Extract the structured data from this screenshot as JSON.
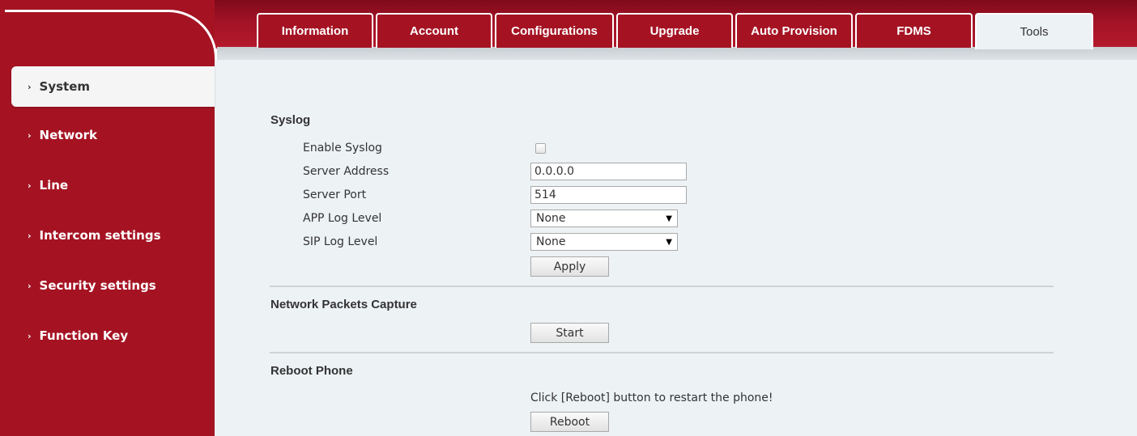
{
  "tabs": [
    {
      "label": "Information"
    },
    {
      "label": "Account"
    },
    {
      "label": "Configurations"
    },
    {
      "label": "Upgrade"
    },
    {
      "label": "Auto Provision"
    },
    {
      "label": "FDMS"
    },
    {
      "label": "Tools"
    }
  ],
  "active_tab": "Tools",
  "sidebar": {
    "items": [
      {
        "label": "System"
      },
      {
        "label": "Network"
      },
      {
        "label": "Line"
      },
      {
        "label": "Intercom settings"
      },
      {
        "label": "Security settings"
      },
      {
        "label": "Function Key"
      }
    ],
    "active": "System",
    "chevron": "›"
  },
  "syslog": {
    "title": "Syslog",
    "enable_label": "Enable Syslog",
    "enable_checked": false,
    "server_address_label": "Server Address",
    "server_address_value": "0.0.0.0",
    "server_port_label": "Server Port",
    "server_port_value": "514",
    "app_log_label": "APP Log Level",
    "app_log_value": "None",
    "sip_log_label": "SIP Log Level",
    "sip_log_value": "None",
    "apply_label": "Apply"
  },
  "capture": {
    "title": "Network Packets Capture",
    "start_label": "Start"
  },
  "reboot": {
    "title": "Reboot Phone",
    "hint": "Click [Reboot] button to restart the phone!",
    "button_label": "Reboot"
  },
  "colors": {
    "brand_red": "#a51323",
    "content_bg": "#edf2f5"
  }
}
